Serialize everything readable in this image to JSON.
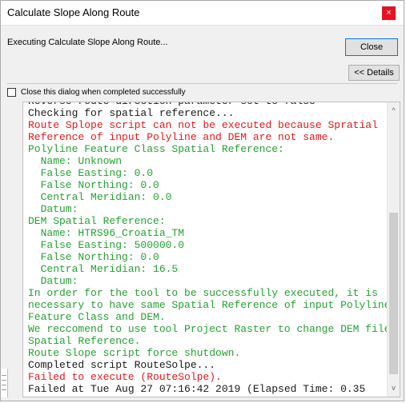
{
  "window": {
    "title": "Calculate Slope Along Route",
    "close_glyph": "×"
  },
  "status": {
    "text": "Executing Calculate Slope Along Route..."
  },
  "buttons": {
    "close_label": "Close",
    "details_label": "<< Details"
  },
  "checkbox": {
    "label": "Close this dialog when completed successfully",
    "checked": false
  },
  "colors": {
    "black": "#1a1a1a",
    "red": "#e31919",
    "green": "#25a233",
    "close_button_accent": "#0078d7",
    "title_close_bg": "#e81123"
  },
  "log": [
    {
      "text": "Reverse route direction parameter set to false",
      "color": "black"
    },
    {
      "text": "Checking for spatial reference...",
      "color": "black"
    },
    {
      "text": "Route Splope script can not be executed because Spratial",
      "color": "red"
    },
    {
      "text": "Reference of input Polyline and DEM are not same.",
      "color": "red"
    },
    {
      "text": "Polyline Feature Class Spatial Reference:",
      "color": "green"
    },
    {
      "text": "  Name: Unknown",
      "color": "green"
    },
    {
      "text": "  False Easting: 0.0",
      "color": "green"
    },
    {
      "text": "  False Northing: 0.0",
      "color": "green"
    },
    {
      "text": "  Central Meridian: 0.0",
      "color": "green"
    },
    {
      "text": "  Datum:",
      "color": "green"
    },
    {
      "text": "DEM Spatial Reference:",
      "color": "green"
    },
    {
      "text": "  Name: HTRS96_Croatia_TM",
      "color": "green"
    },
    {
      "text": "  False Easting: 500000.0",
      "color": "green"
    },
    {
      "text": "  False Northing: 0.0",
      "color": "green"
    },
    {
      "text": "  Central Meridian: 16.5",
      "color": "green"
    },
    {
      "text": "  Datum:",
      "color": "green"
    },
    {
      "text": "In order for the tool to be successfully executed, it is",
      "color": "green"
    },
    {
      "text": "necessary to have same Spatial Reference of input Polyline",
      "color": "green"
    },
    {
      "text": "Feature Class and DEM.",
      "color": "green"
    },
    {
      "text": "We reccomend to use tool Project Raster to change DEM file",
      "color": "green"
    },
    {
      "text": "Spatial Reference.",
      "color": "green"
    },
    {
      "text": "Route Slope script force shutdown.",
      "color": "green"
    },
    {
      "text": "Completed script RouteSolpe...",
      "color": "black"
    },
    {
      "text": "Failed to execute (RouteSolpe).",
      "color": "red"
    },
    {
      "text": "Failed at Tue Aug 27 07:16:42 2019 (Elapsed Time: 0.35",
      "color": "black"
    }
  ],
  "scrollbar": {
    "up_glyph": "^",
    "down_glyph": "v"
  }
}
